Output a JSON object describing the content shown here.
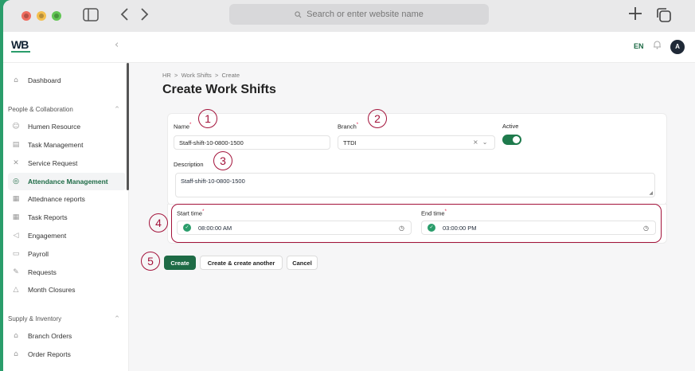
{
  "browser": {
    "search_placeholder": "Search or enter website name",
    "icons": [
      "sidebar-toggle-icon",
      "back-icon",
      "forward-icon",
      "search-icon",
      "new-tab-icon",
      "tabs-icon"
    ]
  },
  "header": {
    "logo_text": "WB",
    "logo_sub": "WORKMOTION BY ISSU",
    "collapse_glyph": "‹",
    "language": "EN",
    "avatar_initial": "A"
  },
  "sidebar": {
    "top_item": {
      "label": "Dashboard",
      "icon": "home-icon"
    },
    "sections": [
      {
        "title": "People & Collaboration",
        "items": [
          {
            "label": "Humen Resource",
            "icon": "users-icon"
          },
          {
            "label": "Task Management",
            "icon": "clipboard-icon"
          },
          {
            "label": "Service Request",
            "icon": "tools-icon"
          },
          {
            "label": "Attendance Management",
            "icon": "fingerprint-icon",
            "active": true
          },
          {
            "label": "Attednance reports",
            "icon": "report-icon"
          },
          {
            "label": "Task Reports",
            "icon": "report-icon"
          },
          {
            "label": "Engagement",
            "icon": "megaphone-icon"
          },
          {
            "label": "Payroll",
            "icon": "payroll-icon"
          },
          {
            "label": "Requests",
            "icon": "edit-icon"
          },
          {
            "label": "Month Closures",
            "icon": "lock-icon"
          }
        ]
      },
      {
        "title": "Supply & Inventory",
        "items": [
          {
            "label": "Branch Orders",
            "icon": "bag-icon"
          },
          {
            "label": "Order Reports",
            "icon": "bag-icon"
          }
        ]
      }
    ]
  },
  "main": {
    "breadcrumb": [
      "HR",
      "Work Shifts",
      "Create"
    ],
    "breadcrumb_sep": ">",
    "title": "Create Work Shifts",
    "form": {
      "name_label": "Name",
      "name_value": "Staff-shift-10-0800-1500",
      "branch_label": "Branch",
      "branch_value": "TTDI",
      "active_label": "Active",
      "active_on": true,
      "description_label": "Description",
      "description_value": "Staff-shift-10-0800-1500",
      "required_mark": "*",
      "start_label": "Start time",
      "start_value": "08:00:00 AM",
      "end_label": "End time",
      "end_value": "03:00:00 PM"
    },
    "buttons": {
      "create": "Create",
      "create_another": "Create & create another",
      "cancel": "Cancel"
    }
  },
  "annotations": [
    "1",
    "2",
    "3",
    "4",
    "5"
  ],
  "colors": {
    "brand": "#1e6b46",
    "accent": "#2a9d6b",
    "annotation": "#a3123a"
  }
}
